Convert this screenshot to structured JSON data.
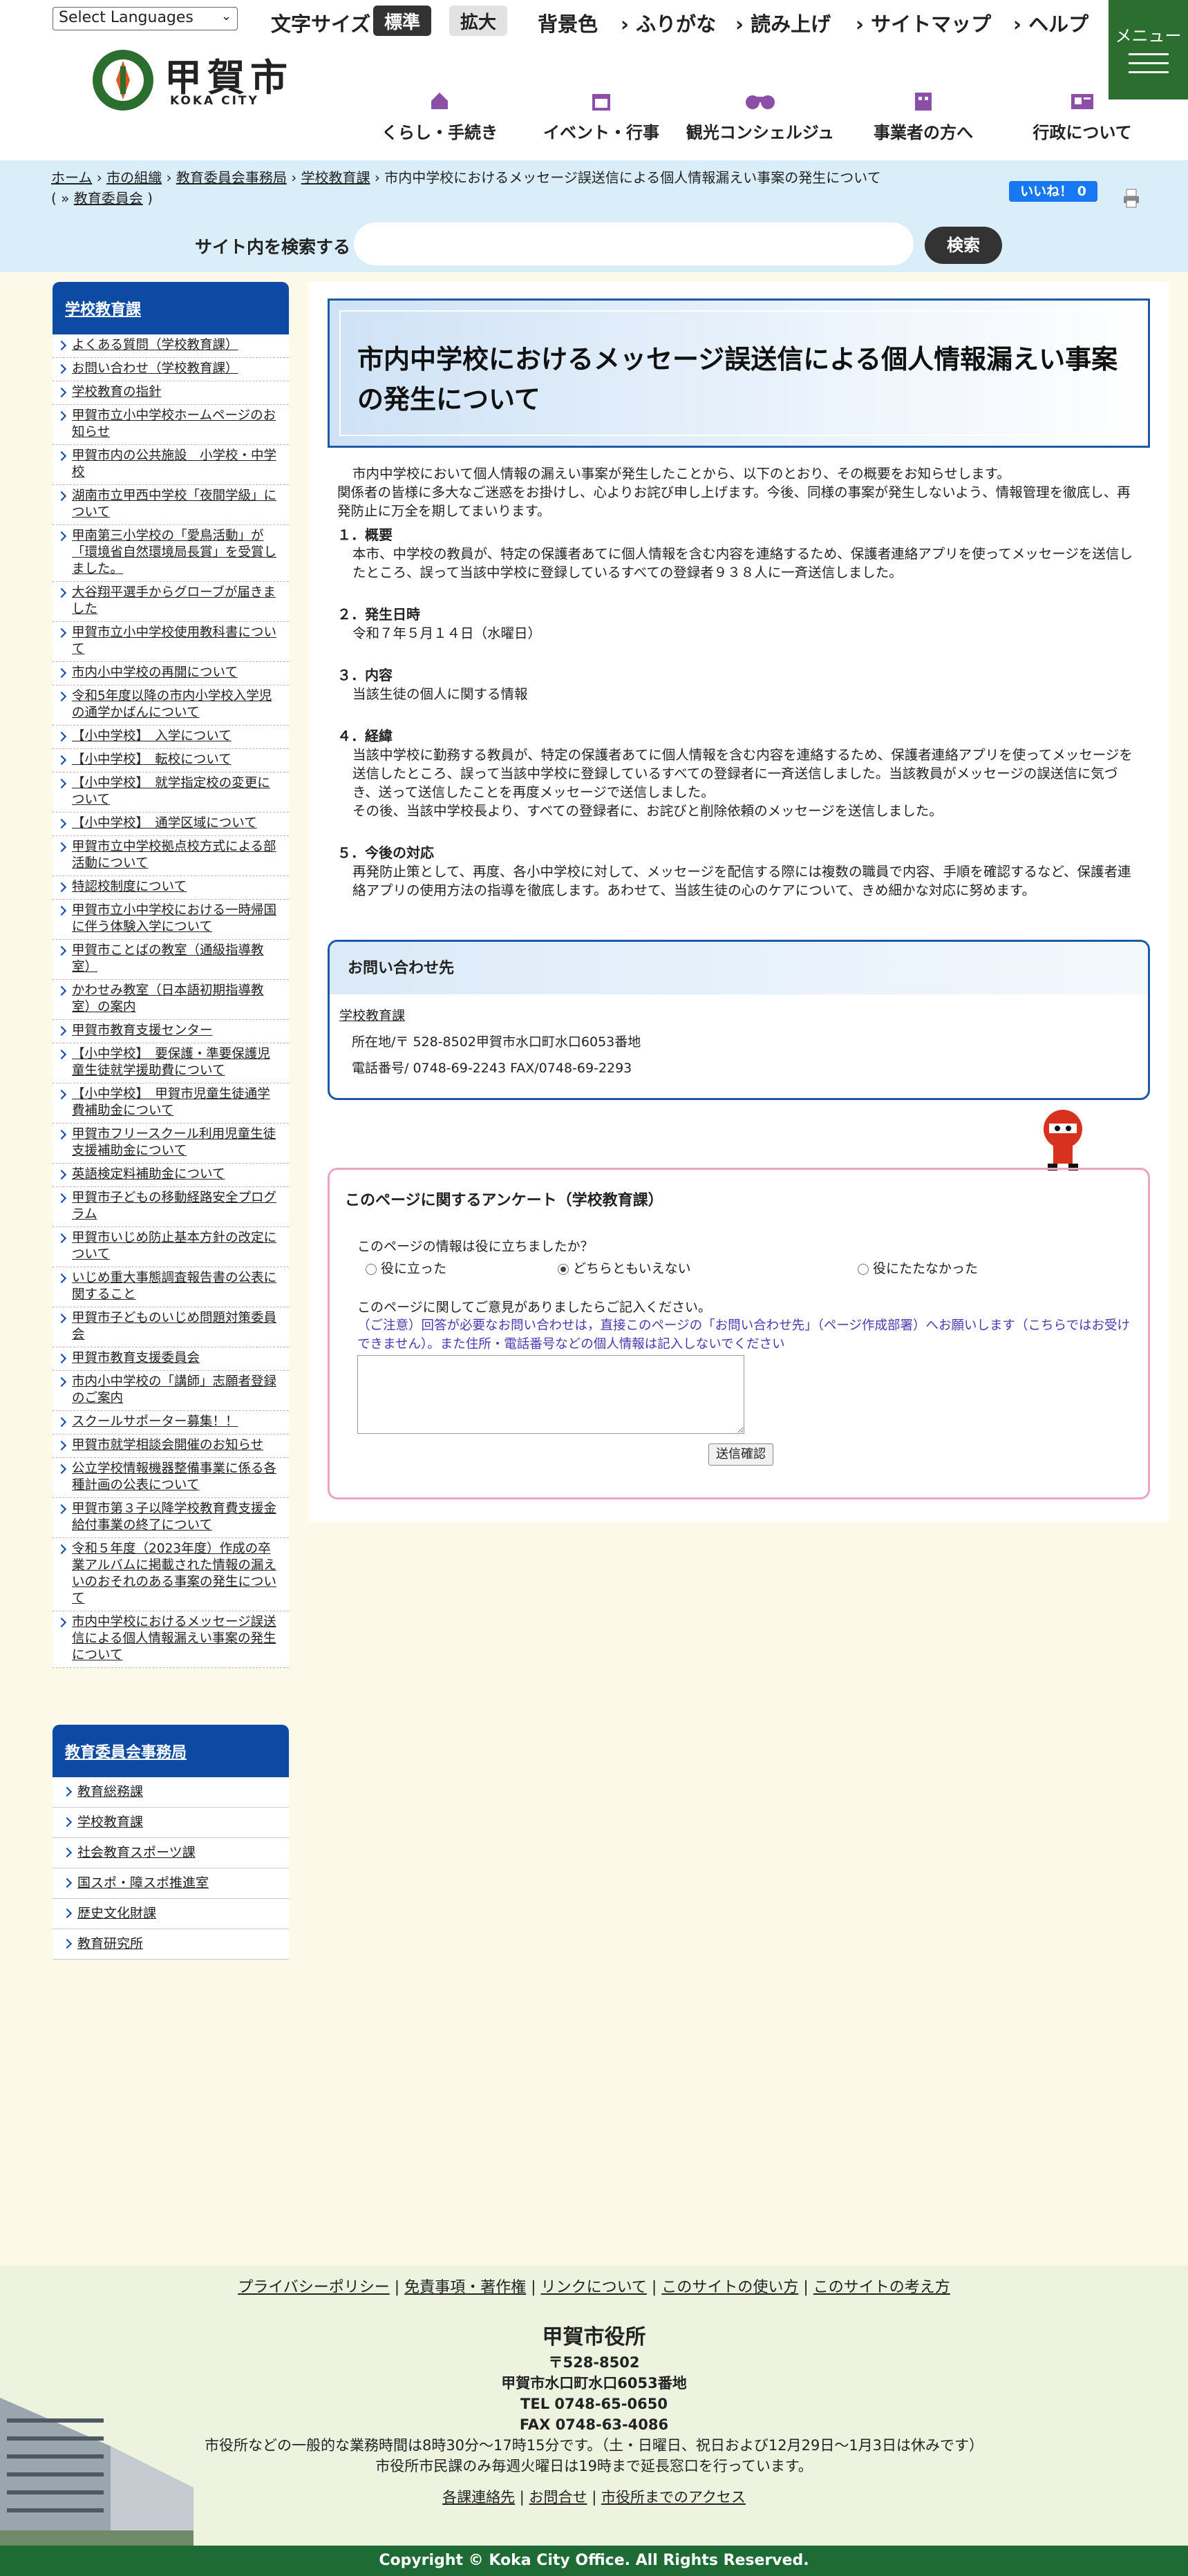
{
  "header": {
    "lang_select": "Select Languages",
    "font_size_label": "文字サイズ",
    "font_standard": "標準",
    "font_large": "拡大",
    "bg_color": "背景色",
    "furigana": "ふりがな",
    "read_aloud": "読み上げ",
    "sitemap": "サイトマップ",
    "help": "ヘルプ",
    "menu": "メニュー",
    "logo_text": "甲賀市",
    "logo_sub": "KOKA CITY"
  },
  "gnav": [
    {
      "label": "くらし・手続き",
      "icon": "house-icon"
    },
    {
      "label": "イベント・行事",
      "icon": "calendar-icon"
    },
    {
      "label": "観光コンシェルジュ",
      "icon": "binoculars-icon"
    },
    {
      "label": "事業者の方へ",
      "icon": "office-icon"
    },
    {
      "label": "行政について",
      "icon": "newspaper-icon"
    }
  ],
  "breadcrumb": {
    "items": [
      "ホーム",
      "市の組織",
      "教育委員会事務局",
      "学校教育課"
    ],
    "current": "市内中学校におけるメッセージ誤送信による個人情報漏えい事案の発生について",
    "dept": "教育委員会"
  },
  "like_label": "いいね！ 0",
  "search": {
    "label": "サイト内を検索する",
    "placeholder": "",
    "button": "検索"
  },
  "sidebar": {
    "title": "学校教育課",
    "items": [
      "よくある質問（学校教育課）",
      "お問い合わせ（学校教育課）",
      "学校教育の指針",
      "甲賀市立小中学校ホームページのお知らせ",
      "甲賀市内の公共施設　小学校・中学校",
      "湖南市立甲西中学校「夜間学級」について",
      "甲南第三小学校の「愛鳥活動」が「環境省自然環境局長賞」を受賞しました。",
      "大谷翔平選手からグローブが届きました",
      "甲賀市立小中学校使用教科書について",
      "市内小中学校の再開について",
      "令和5年度以降の市内小学校入学児の通学かばんについて",
      "【小中学校】　入学について",
      "【小中学校】　転校について",
      "【小中学校】　就学指定校の変更について",
      "【小中学校】　通学区域について",
      "甲賀市立中学校拠点校方式による部活動について",
      "特認校制度について",
      "甲賀市立小中学校における一時帰国に伴う体験入学について",
      "甲賀市ことばの教室（通級指導教室）",
      "かわせみ教室（日本語初期指導教室）の案内",
      "甲賀市教育支援センター",
      "【小中学校】　要保護・準要保護児童生徒就学援助費について",
      "【小中学校】　甲賀市児童生徒通学費補助金について",
      "甲賀市フリースクール利用児童生徒支援補助金について",
      "英語検定料補助金について",
      "甲賀市子どもの移動経路安全プログラム",
      "甲賀市いじめ防止基本方針の改定について",
      "いじめ重大事態調査報告書の公表に関すること",
      "甲賀市子どものいじめ問題対策委員会",
      "甲賀市教育支援委員会",
      "市内小中学校の「講師」志願者登録のご案内",
      "スクールサポーター募集！！",
      "甲賀市就学相談会開催のお知らせ",
      "公立学校情報機器整備事業に係る各種計画の公表について",
      "甲賀市第３子以降学校教育費支援金給付事業の終了について",
      "令和５年度（2023年度）作成の卒業アルバムに掲載された情報の漏えいのおそれのある事案の発生について",
      "市内中学校におけるメッセージ誤送信による個人情報漏えい事案の発生について"
    ],
    "title2": "教育委員会事務局",
    "items2": [
      "教育総務課",
      "学校教育課",
      "社会教育スポーツ課",
      "国スポ・障スポ推進室",
      "歴史文化財課",
      "教育研究所"
    ]
  },
  "article": {
    "title": "市内中学校におけるメッセージ誤送信による個人情報漏えい事案の発生について",
    "intro1": "市内中学校において個人情報の漏えい事案が発生したことから、以下のとおり、その概要をお知らせします。",
    "intro2": "関係者の皆様に多大なご迷惑をお掛けし、心よりお詫び申し上げます。今後、同様の事案が発生しないよう、情報管理を徹底し、再発防止に万全を期してまいります。",
    "s1_head": "１．概要",
    "s1_body": "本市、中学校の教員が、特定の保護者あてに個人情報を含む内容を連絡するため、保護者連絡アプリを使ってメッセージを送信したところ、誤って当該中学校に登録しているすべての登録者９３８人に一斉送信しました。",
    "s2_head": "２．発生日時",
    "s2_body": "令和７年５月１４日（水曜日）",
    "s3_head": "３．内容",
    "s3_body": "当該生徒の個人に関する情報",
    "s4_head": "４．経緯",
    "s4_body1": "当該中学校に勤務する教員が、特定の保護者あてに個人情報を含む内容を連絡するため、保護者連絡アプリを使ってメッセージを送信したところ、誤って当該中学校に登録しているすべての登録者に一斉送信しました。当該教員がメッセージの誤送信に気づき、送って送信したことを再度メッセージで送信しました。",
    "s4_body2": "その後、当該中学校長より、すべての登録者に、お詫びと削除依頼のメッセージを送信しました。",
    "s5_head": "５．今後の対応",
    "s5_body": "再発防止策として、再度、各小中学校に対して、メッセージを配信する際には複数の職員で内容、手順を確認するなど、保護者連絡アプリの使用方法の指導を徹底します。あわせて、当該生徒の心のケアについて、きめ細かな対応に努めます。"
  },
  "contact": {
    "heading": "お問い合わせ先",
    "dept": "学校教育課",
    "address": "所在地/〒 528-8502甲賀市水口町水口6053番地",
    "phone": "電話番号/ 0748-69-2243 FAX/0748-69-2293"
  },
  "survey": {
    "title": "このページに関するアンケート（学校教育課）",
    "q1": "このページの情報は役に立ちましたか？",
    "options": [
      "役に立った",
      "どちらともいえない",
      "役にたたなかった"
    ],
    "selected_index": 1,
    "q2": "このページに関してご意見がありましたらご記入ください。",
    "note": "（ご注意）回答が必要なお問い合わせは，直接このページの「お問い合わせ先」（ページ作成部署）へお願いします（こちらではお受けできません）。また住所・電話番号などの個人情報は記入しないでください",
    "submit": "送信確認"
  },
  "footer": {
    "links": [
      "プライバシーポリシー",
      "免責事項・著作権",
      "リンクについて",
      "このサイトの使い方",
      "このサイトの考え方"
    ],
    "org": "甲賀市役所",
    "zip": "〒528-8502",
    "address": "甲賀市水口町水口6053番地",
    "tel": "TEL 0748-65-0650",
    "fax": "FAX 0748-63-4086",
    "hours1": "市役所などの一般的な業務時間は8時30分〜17時15分です。（土・日曜日、祝日および12月29日〜1月3日は休みです）",
    "hours2": "市役所市民課のみ毎週火曜日は19時まで延長窓口を行っています。",
    "bottom_links": [
      "各課連絡先",
      "お問合せ",
      "市役所までのアクセス"
    ],
    "copyright": "Copyright © Koka City Office. All Rights Reserved."
  },
  "colors": {
    "brand_green": "#2b6e2f",
    "nav_blue": "#0d4aa3",
    "band_blue": "#daeefa",
    "survey_pink": "#f0a2c4"
  }
}
